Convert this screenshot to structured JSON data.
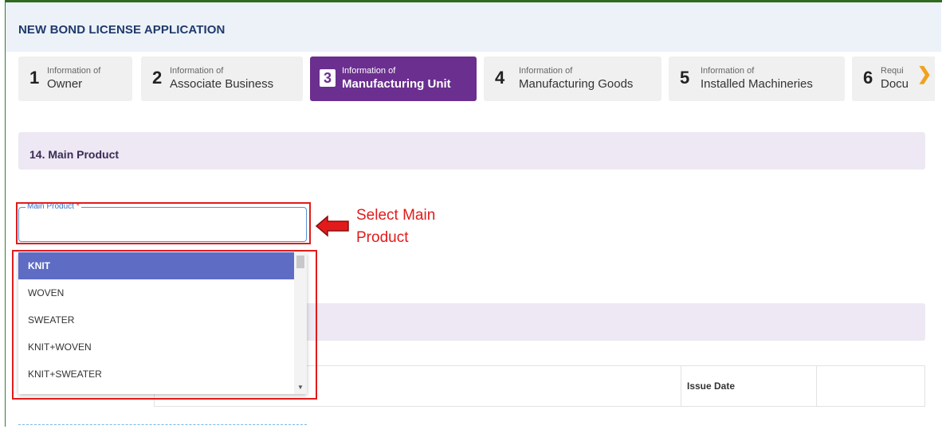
{
  "app": {
    "title": "NEW BOND LICENSE APPLICATION"
  },
  "steps": [
    {
      "num": "1",
      "small": "Information of",
      "big": "Owner",
      "active": false
    },
    {
      "num": "2",
      "small": "Information of",
      "big": "Associate Business",
      "active": false
    },
    {
      "num": "3",
      "small": "Information of",
      "big": "Manufacturing Unit",
      "active": true
    },
    {
      "num": "4",
      "small": "Information of",
      "big": "Manufacturing Goods",
      "active": false
    },
    {
      "num": "5",
      "small": "Information of",
      "big": "Installed Machineries",
      "active": false
    },
    {
      "num": "6",
      "small": "Requi",
      "big": "Docu",
      "active": false
    }
  ],
  "section": {
    "title": "14. Main Product"
  },
  "field": {
    "label": "Main Product",
    "required_mark": "*",
    "value": ""
  },
  "dropdown": {
    "options": [
      "KNIT",
      "WOVEN",
      "SWEATER",
      "KNIT+WOVEN",
      "KNIT+SWEATER"
    ],
    "selected": "KNIT"
  },
  "annotation": {
    "line1": "Select Main",
    "line2": "Product"
  },
  "table": {
    "issue_date_header": "Issue Date"
  },
  "colors": {
    "accent": "#6b2f8f",
    "highlight": "#e11b1b",
    "selected_option": "#5f6cc4",
    "next_arrow": "#f0a21e"
  }
}
